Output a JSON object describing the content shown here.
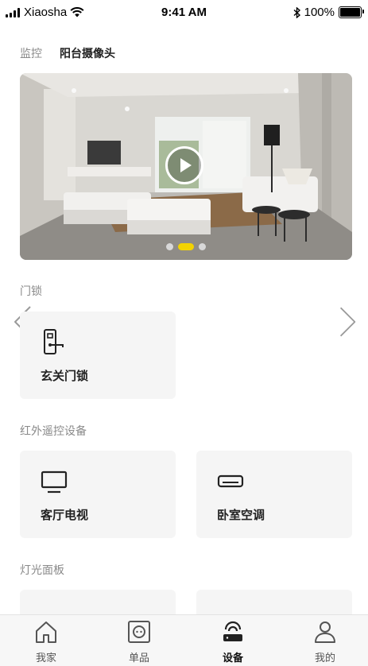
{
  "status_bar": {
    "carrier": "Xiaosha",
    "time": "9:41 AM",
    "battery": "100%"
  },
  "monitor": {
    "label": "监控",
    "camera_name": "阳台摄像头",
    "carousel_page": 2,
    "carousel_total": 3
  },
  "sections": {
    "door_lock": {
      "title": "门锁",
      "devices": [
        {
          "name": "玄关门锁",
          "icon": "door-lock-icon"
        }
      ]
    },
    "ir_remote": {
      "title": "红外遥控设备",
      "devices": [
        {
          "name": "客厅电视",
          "icon": "tv-icon"
        },
        {
          "name": "卧室空调",
          "icon": "air-conditioner-icon"
        }
      ]
    },
    "light_panel": {
      "title": "灯光面板"
    }
  },
  "tab_bar": {
    "items": [
      {
        "label": "我家",
        "icon": "home-icon"
      },
      {
        "label": "单品",
        "icon": "socket-icon"
      },
      {
        "label": "设备",
        "icon": "router-icon",
        "active": true
      },
      {
        "label": "我的",
        "icon": "user-icon"
      }
    ]
  },
  "colors": {
    "accent": "#f3d300",
    "card_bg": "#f5f5f5",
    "section_title": "#8a8a8a"
  }
}
